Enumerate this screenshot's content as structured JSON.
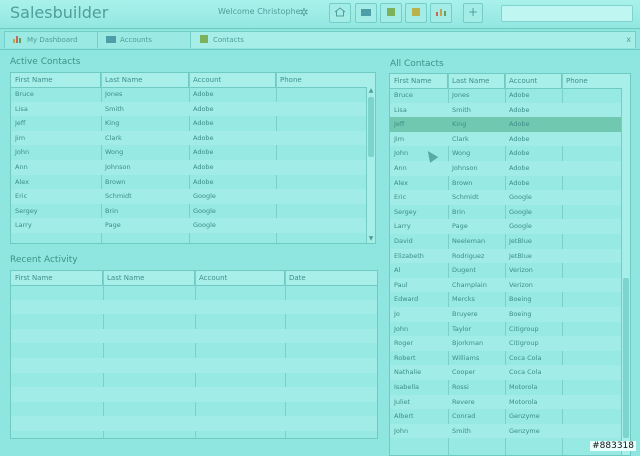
{
  "app_title": "Salesbuilder",
  "welcome": "Welcome Christophe",
  "tabs": [
    {
      "label": "My Dashboard"
    },
    {
      "label": "Accounts"
    },
    {
      "label": "Contacts",
      "close": "x"
    }
  ],
  "active_contacts": {
    "title": "Active Contacts",
    "columns": [
      "First Name",
      "Last Name",
      "Account",
      "Phone"
    ],
    "rows": [
      [
        "Bruce",
        "Jones",
        "Adobe",
        ""
      ],
      [
        "Lisa",
        "Smith",
        "Adobe",
        ""
      ],
      [
        "Jeff",
        "King",
        "Adobe",
        ""
      ],
      [
        "Jim",
        "Clark",
        "Adobe",
        ""
      ],
      [
        "John",
        "Wong",
        "Adobe",
        ""
      ],
      [
        "Ann",
        "Johnson",
        "Adobe",
        ""
      ],
      [
        "Alex",
        "Brown",
        "Adobe",
        ""
      ],
      [
        "Eric",
        "Schmidt",
        "Google",
        ""
      ],
      [
        "Sergey",
        "Brin",
        "Google",
        ""
      ],
      [
        "Larry",
        "Page",
        "Google",
        ""
      ]
    ]
  },
  "recent_activity": {
    "title": "Recent Activity",
    "columns": [
      "First Name",
      "Last Name",
      "Account",
      "Date"
    ]
  },
  "all_contacts": {
    "title": "All Contacts",
    "columns": [
      "First Name",
      "Last Name",
      "Account",
      "Phone"
    ],
    "rows": [
      [
        "Bruce",
        "Jones",
        "Adobe",
        ""
      ],
      [
        "Lisa",
        "Smith",
        "Adobe",
        ""
      ],
      [
        "Jeff",
        "King",
        "Adobe",
        ""
      ],
      [
        "Jim",
        "Clark",
        "Adobe",
        ""
      ],
      [
        "John",
        "Wong",
        "Adobe",
        ""
      ],
      [
        "Ann",
        "Johnson",
        "Adobe",
        ""
      ],
      [
        "Alex",
        "Brown",
        "Adobe",
        ""
      ],
      [
        "Eric",
        "Schmidt",
        "Google",
        ""
      ],
      [
        "Sergey",
        "Brin",
        "Google",
        ""
      ],
      [
        "Larry",
        "Page",
        "Google",
        ""
      ],
      [
        "David",
        "Neeleman",
        "JetBlue",
        ""
      ],
      [
        "Elizabeth",
        "Rodriguez",
        "JetBlue",
        ""
      ],
      [
        "Al",
        "Dugent",
        "Verizon",
        ""
      ],
      [
        "Paul",
        "Champlain",
        "Verizon",
        ""
      ],
      [
        "Edward",
        "Mercks",
        "Boeing",
        ""
      ],
      [
        "Jo",
        "Bruyere",
        "Boeing",
        ""
      ],
      [
        "John",
        "Taylor",
        "Citigroup",
        ""
      ],
      [
        "Roger",
        "Bjorkman",
        "Citigroup",
        ""
      ],
      [
        "Robert",
        "Williams",
        "Coca Cola",
        ""
      ],
      [
        "Nathalie",
        "Cooper",
        "Coca Cola",
        ""
      ],
      [
        "Isabella",
        "Rossi",
        "Motorola",
        ""
      ],
      [
        "Juliet",
        "Revere",
        "Motorola",
        ""
      ],
      [
        "Albert",
        "Conrad",
        "Genzyme",
        ""
      ],
      [
        "John",
        "Smith",
        "Genzyme",
        ""
      ]
    ]
  },
  "watermark": "#883318",
  "colors": {
    "accent": "#71c8b0",
    "background": "#8fe6e0"
  }
}
